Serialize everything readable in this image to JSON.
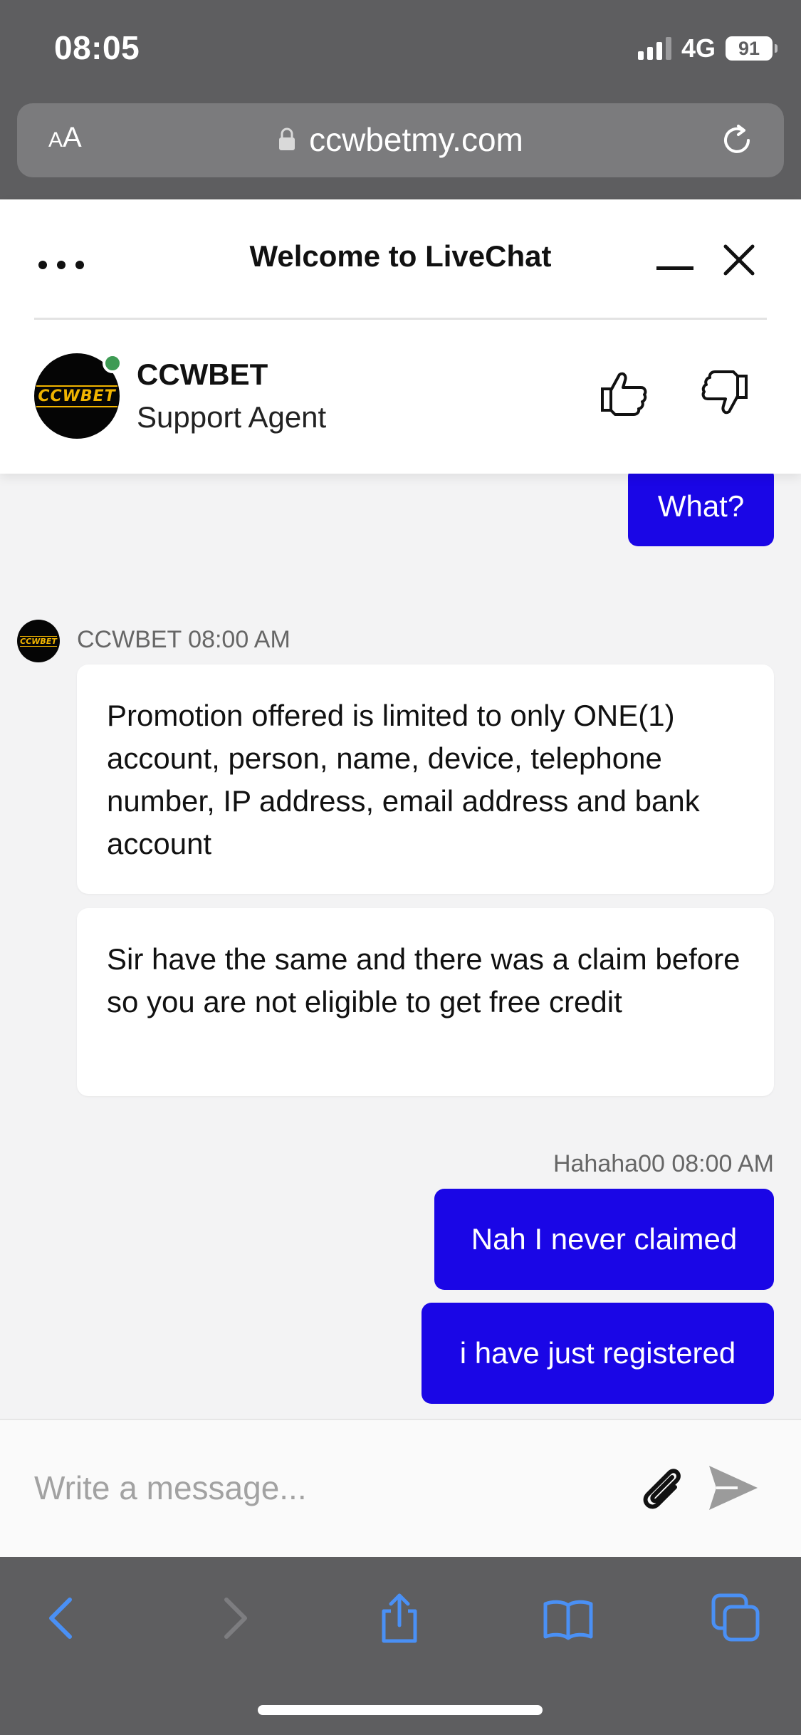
{
  "status_bar": {
    "time": "08:05",
    "network": "4G",
    "battery": "91"
  },
  "browser": {
    "text_size_label_small": "A",
    "text_size_label_large": "A",
    "url": "ccwbetmy.com"
  },
  "chat": {
    "header_title": "Welcome to LiveChat",
    "agent": {
      "name": "CCWBET",
      "role": "Support Agent",
      "logo_text": "CCWBET",
      "status_color": "#3e9b54"
    },
    "messages": {
      "user_partial": "What?",
      "agent_meta": "CCWBET 08:00 AM",
      "agent_msg_1": "Promotion offered is limited to only ONE(1) account, person, name, device, telephone number, IP address, email address and bank account",
      "agent_msg_2": "Sir have the same and there was a claim before so you are not eligible to get free credit",
      "user_meta": "Hahaha00 08:00 AM",
      "user_msg_1": "Nah I never claimed",
      "user_msg_2": "i have just registered"
    },
    "composer_placeholder": "Write a message..."
  },
  "colors": {
    "user_bubble": "#1a06e6",
    "chrome": "#5e5e60",
    "toolbar_icon": "#4a90f5"
  },
  "icons": [
    "lock-icon",
    "reload-icon",
    "more-icon",
    "minimize-icon",
    "close-icon",
    "thumbs-up-icon",
    "thumbs-down-icon",
    "attach-icon",
    "send-icon",
    "back-icon",
    "forward-icon",
    "share-icon",
    "bookmarks-icon",
    "tabs-icon"
  ]
}
